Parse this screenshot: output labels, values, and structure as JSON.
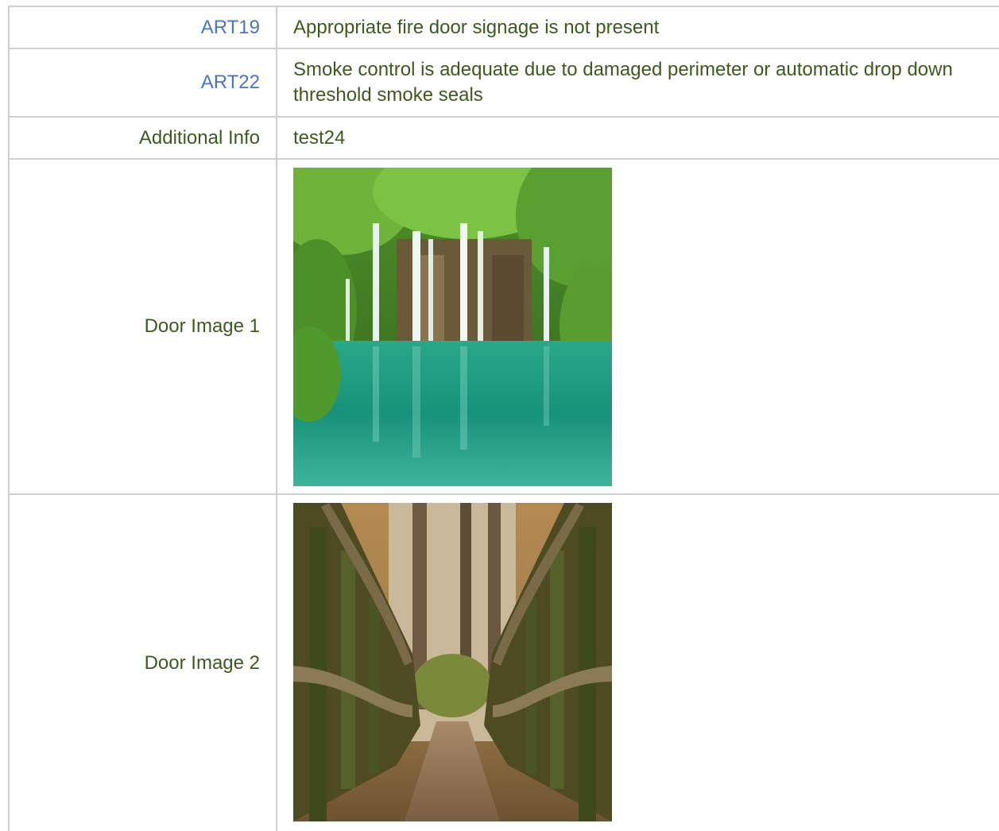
{
  "rows": [
    {
      "label": "ART19",
      "value": "Appropriate fire door signage is not present"
    },
    {
      "label": "ART22",
      "value": "Smoke control is adequate due to damaged perimeter or automatic drop down threshold smoke seals"
    },
    {
      "label": "Additional Info",
      "value": "test24"
    },
    {
      "label": "Door Image 1"
    },
    {
      "label": "Door Image 2"
    }
  ],
  "colors": {
    "link": "#4a74c4",
    "text": "#3d5a1e",
    "border": "#cfcfcf"
  }
}
